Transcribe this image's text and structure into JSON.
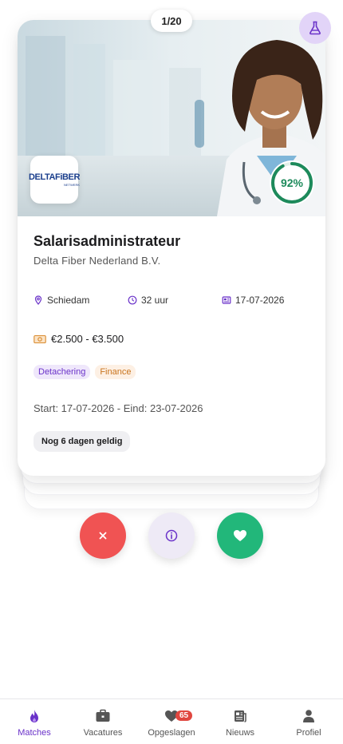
{
  "counter": "1/20",
  "job": {
    "company_logo": {
      "brand": "DELTAFiBER",
      "sub": "NETWERK"
    },
    "match_score": "92%",
    "match_percent": 92,
    "title": "Salarisadministrateur",
    "company": "Delta Fiber Nederland B.V.",
    "location": "Schiedam",
    "hours": "32 uur",
    "date": "17-07-2026",
    "salary": "€2.500 - €3.500",
    "tags": [
      {
        "label": "Detachering",
        "color": "purple"
      },
      {
        "label": "Finance",
        "color": "orange"
      }
    ],
    "dates": "Start: 17-07-2026 - Eind: 23-07-2026",
    "validity": "Nog 6 dagen geldig"
  },
  "actions": {
    "reject_icon": "close-icon",
    "info_icon": "info-icon",
    "like_icon": "heart-icon"
  },
  "tabbar": {
    "items": [
      {
        "label": "Matches",
        "icon": "flame-icon",
        "active": true
      },
      {
        "label": "Vacatures",
        "icon": "briefcase-icon",
        "active": false
      },
      {
        "label": "Opgeslagen",
        "icon": "heart-icon",
        "active": false,
        "badge": "65"
      },
      {
        "label": "Nieuws",
        "icon": "newspaper-icon",
        "active": false
      },
      {
        "label": "Profiel",
        "icon": "person-icon",
        "active": false
      }
    ]
  },
  "colors": {
    "accent": "#6a32c9",
    "score": "#1d8a5b",
    "reject": "#f05353",
    "like": "#22b77a",
    "badge": "#e0463f"
  }
}
